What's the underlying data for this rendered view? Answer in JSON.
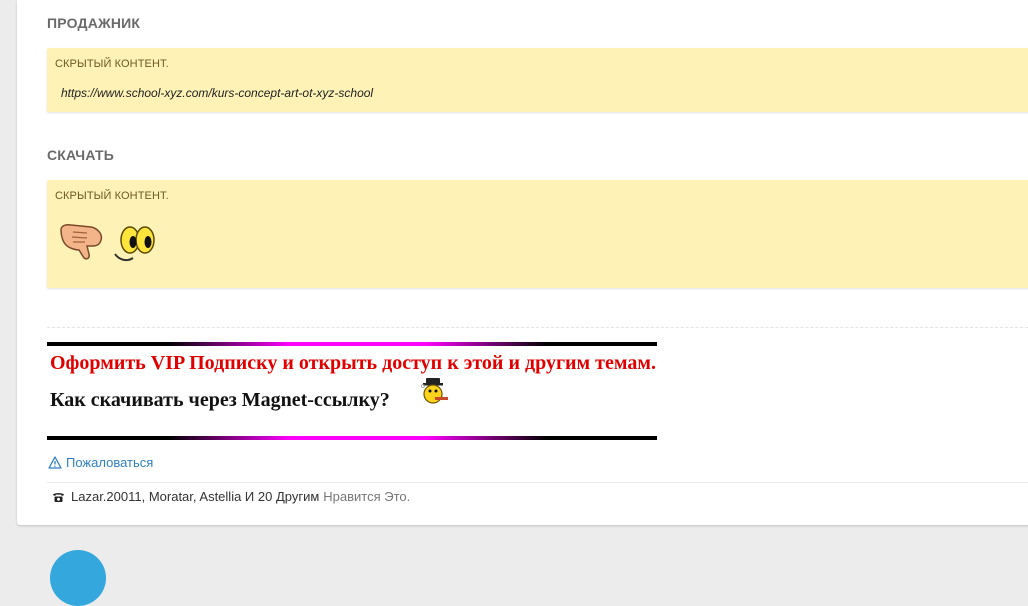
{
  "sections": {
    "seller_heading": "ПРОДАЖНИК",
    "seller_box_title": "СКРЫТЫЙ КОНТЕНТ.",
    "seller_link": "https://www.school-xyz.com/kurs-concept-art-ot-xyz-school",
    "download_heading": "СКАЧАТЬ",
    "download_box_title": "СКРЫТЫЙ КОНТЕНТ."
  },
  "promo": {
    "vip_text": "Оформить VIP Подписку и открыть доступ к этой и другим темам.",
    "magnet_text": "Как скачивать через Magnet-ссылку?"
  },
  "actions": {
    "report_label": "Пожаловаться"
  },
  "likes": {
    "users": "Lazar.20011, Moratar, Astellia И 20 Другим",
    "suffix": "Нравится Это."
  },
  "icons": {
    "pointing_hand": "pointing-hand-icon",
    "eyes": "eyes-smiley-icon",
    "smoking_smiley": "smoking-smiley-icon",
    "warning": "warning-icon",
    "phone": "phone-icon"
  },
  "colors": {
    "hidden_bg": "#fff2b7",
    "vip_red": "#e00000",
    "link_blue": "#2f7fc2",
    "glow_magenta": "#ff00ff"
  }
}
